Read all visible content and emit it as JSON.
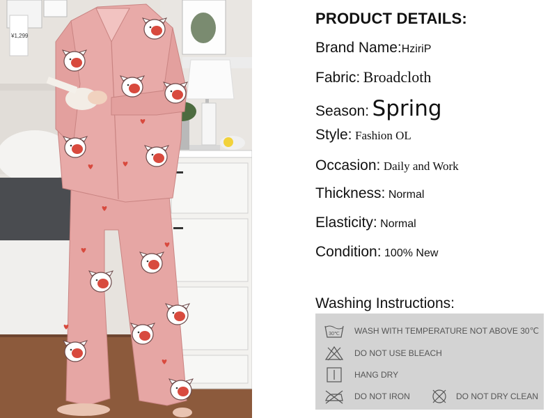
{
  "photo": {
    "price_tag": "¥1,299",
    "colors": {
      "pajama": "#e6a6a4",
      "pig": "#ffffff",
      "heart": "#d84a3e",
      "floor": "#8c5a3c"
    }
  },
  "details": {
    "heading": "PRODUCT DETAILS:",
    "rows": [
      {
        "label": "Brand Name:",
        "value": "HziriP"
      },
      {
        "label": "Fabric:",
        "value": "Broadcloth"
      },
      {
        "label": "Season:",
        "value": "Spring"
      },
      {
        "label": "Style:",
        "value": "Fashion OL"
      },
      {
        "label": "Occasion:",
        "value": "Daily and Work"
      },
      {
        "label": "Thickness:",
        "value": "Normal"
      },
      {
        "label": "Elasticity:",
        "value": "Normal"
      },
      {
        "label": "Condition:",
        "value": "100% New"
      }
    ]
  },
  "washing": {
    "title": "Washing Instructions:",
    "items": [
      {
        "icon": "wash-30-icon",
        "icon_text": "30℃",
        "text": "WASH WITH TEMPERATURE NOT ABOVE 30℃"
      },
      {
        "icon": "no-bleach-icon",
        "text": "DO NOT USE BLEACH"
      },
      {
        "icon": "hang-dry-icon",
        "text": "HANG DRY"
      },
      {
        "icon": "no-iron-icon",
        "text": "DO NOT IRON"
      },
      {
        "icon": "no-dry-clean-icon",
        "text": "DO NOT DRY CLEAN"
      }
    ]
  }
}
